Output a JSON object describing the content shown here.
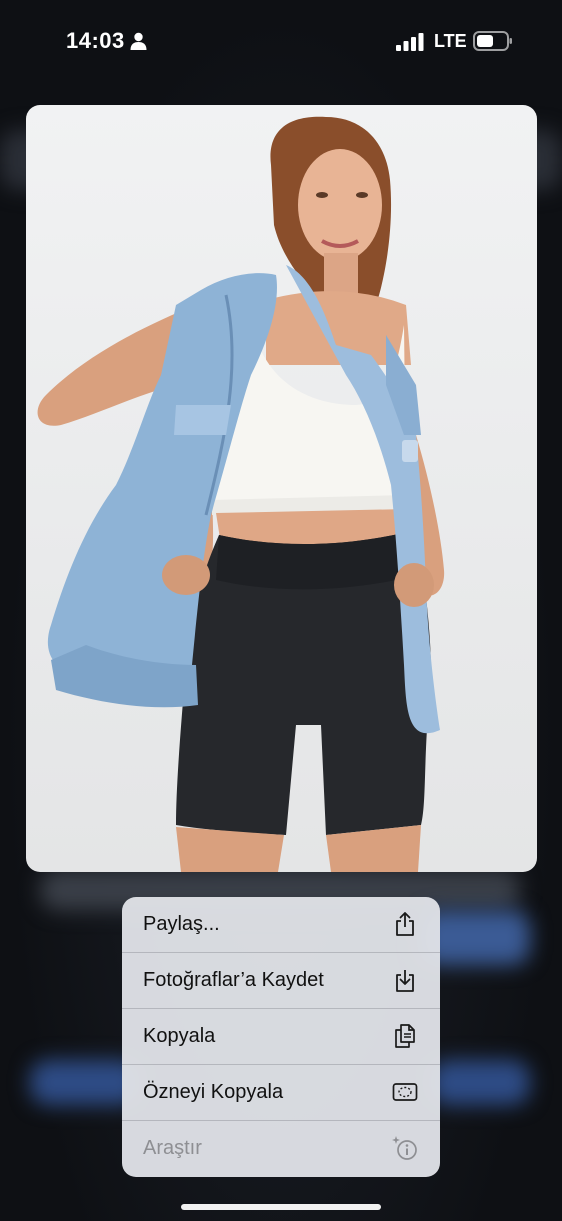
{
  "status_bar": {
    "time": "14:03",
    "network": "LTE",
    "icons": [
      "person-icon",
      "signal-icon",
      "battery-icon"
    ]
  },
  "preview": {
    "description_icon": "photo-preview"
  },
  "context_menu": {
    "items": [
      {
        "label": "Paylaş...",
        "icon": "share-icon",
        "enabled": true
      },
      {
        "label": "Fotoğraflar’a Kaydet",
        "icon": "save-download-icon",
        "enabled": true
      },
      {
        "label": "Kopyala",
        "icon": "copy-icon",
        "enabled": true
      },
      {
        "label": "Özneyi Kopyala",
        "icon": "copy-subject-icon",
        "enabled": true
      },
      {
        "label": "Araştır",
        "icon": "visual-lookup-icon",
        "enabled": false
      }
    ]
  },
  "colors": {
    "menu_background": "#e0e2e7",
    "disabled_text": "#8e8f93",
    "screen_background": "#101216"
  }
}
